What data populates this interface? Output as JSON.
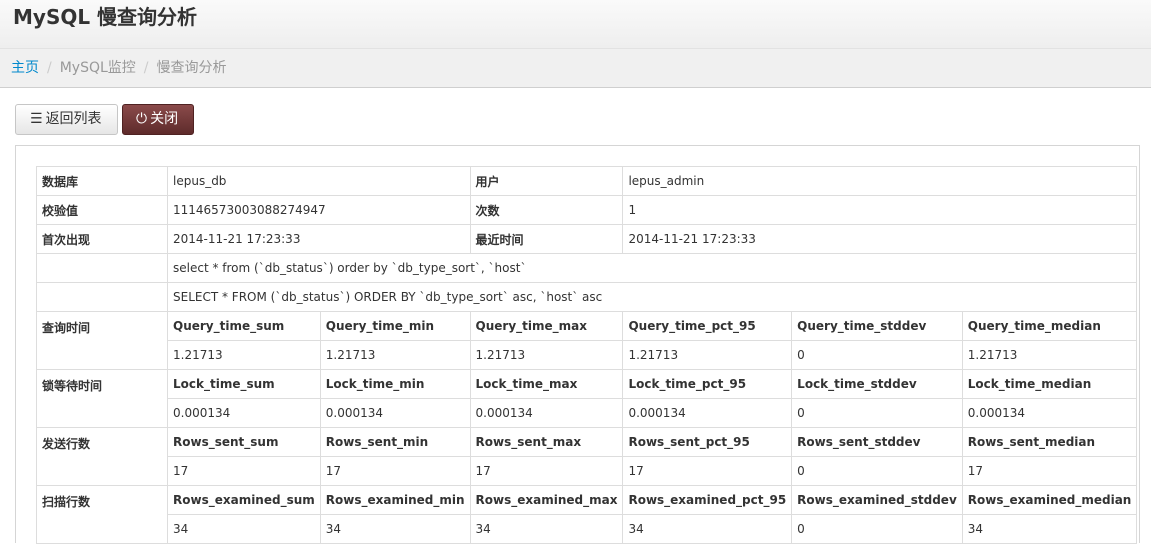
{
  "page": {
    "title": "MySQL 慢查询分析"
  },
  "breadcrumb": {
    "home": "主页",
    "parent": "MySQL监控",
    "current": "慢查询分析"
  },
  "toolbar": {
    "back_label": "返回列表",
    "close_label": "关闭"
  },
  "info": {
    "db_label": "数据库",
    "db_value": "lepus_db",
    "user_label": "用户",
    "user_value": "lepus_admin",
    "checksum_label": "校验值",
    "checksum_value": "11146573003088274947",
    "count_label": "次数",
    "count_value": "1",
    "first_label": "首次出现",
    "first_value": "2014-11-21 17:23:33",
    "last_label": "最近时间",
    "last_value": "2014-11-21 17:23:33",
    "sample": "select * from (`db_status`) order by `db_type_sort`, `host`",
    "fingerprint": "SELECT * FROM (`db_status`) ORDER BY `db_type_sort` asc, `host` asc"
  },
  "stats": {
    "query": {
      "label": "查询时间",
      "headers": [
        "Query_time_sum",
        "Query_time_min",
        "Query_time_max",
        "Query_time_pct_95",
        "Query_time_stddev",
        "Query_time_median"
      ],
      "values": [
        "1.21713",
        "1.21713",
        "1.21713",
        "1.21713",
        "0",
        "1.21713"
      ]
    },
    "lock": {
      "label": "锁等待时间",
      "headers": [
        "Lock_time_sum",
        "Lock_time_min",
        "Lock_time_max",
        "Lock_time_pct_95",
        "Lock_time_stddev",
        "Lock_time_median"
      ],
      "values": [
        "0.000134",
        "0.000134",
        "0.000134",
        "0.000134",
        "0",
        "0.000134"
      ]
    },
    "sent": {
      "label": "发送行数",
      "headers": [
        "Rows_sent_sum",
        "Rows_sent_min",
        "Rows_sent_max",
        "Rows_sent_pct_95",
        "Rows_sent_stddev",
        "Rows_sent_median"
      ],
      "values": [
        "17",
        "17",
        "17",
        "17",
        "0",
        "17"
      ]
    },
    "examined": {
      "label": "扫描行数",
      "headers": [
        "Rows_examined_sum",
        "Rows_examined_min",
        "Rows_examined_max",
        "Rows_examined_pct_95",
        "Rows_examined_stddev",
        "Rows_examined_median"
      ],
      "values": [
        "34",
        "34",
        "34",
        "34",
        "0",
        "34"
      ]
    }
  }
}
